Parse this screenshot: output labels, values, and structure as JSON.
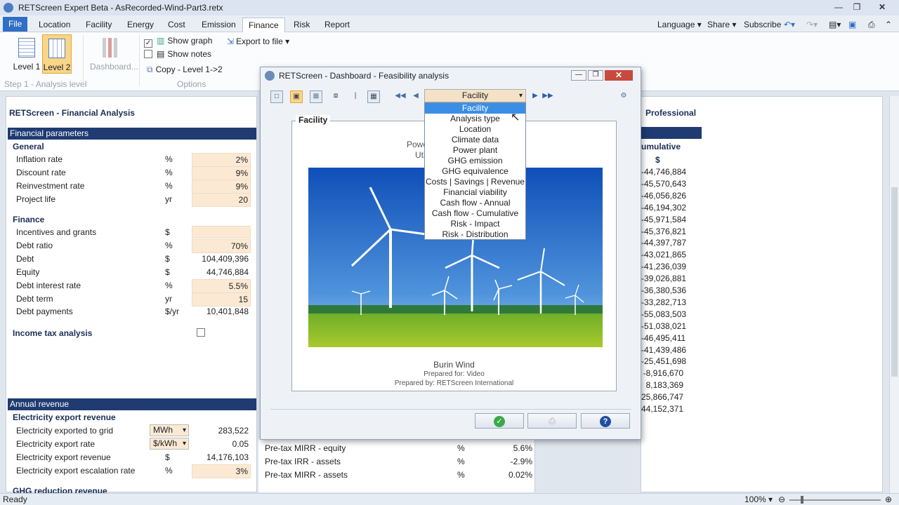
{
  "window": {
    "title": "RETScreen Expert Beta - AsRecorded-Wind-Part3.retx"
  },
  "menu": {
    "items": [
      "File",
      "Location",
      "Facility",
      "Energy",
      "Cost",
      "Emission",
      "Finance",
      "Risk",
      "Report"
    ],
    "right": [
      "Language",
      "Share",
      "Subscribe"
    ]
  },
  "ribbon": {
    "level1": "Level 1",
    "level2": "Level 2",
    "dashboard": "Dashboard...",
    "show_graph": "Show graph",
    "show_notes": "Show notes",
    "copy": "Copy - Level 1->2",
    "export": "Export to file",
    "group1": "Step 1 - Analysis level",
    "group2": "Options"
  },
  "left": {
    "title": "RETScreen - Financial Analysis",
    "section1": "Financial parameters",
    "general": "General",
    "general_rows": [
      {
        "label": "Inflation rate",
        "unit": "%",
        "value": "2%"
      },
      {
        "label": "Discount rate",
        "unit": "%",
        "value": "9%"
      },
      {
        "label": "Reinvestment rate",
        "unit": "%",
        "value": "9%"
      },
      {
        "label": "Project life",
        "unit": "yr",
        "value": "20"
      }
    ],
    "finance": "Finance",
    "finance_rows": [
      {
        "label": "Incentives and grants",
        "unit": "$",
        "value": ""
      },
      {
        "label": "Debt ratio",
        "unit": "%",
        "value": "70%"
      },
      {
        "label": "Debt",
        "unit": "$",
        "value": "104,409,396"
      },
      {
        "label": "Equity",
        "unit": "$",
        "value": "44,746,884"
      },
      {
        "label": "Debt interest rate",
        "unit": "%",
        "value": "5.5%"
      },
      {
        "label": "Debt term",
        "unit": "yr",
        "value": "15"
      },
      {
        "label": "Debt payments",
        "unit": "$/yr",
        "value": "10,401,848"
      }
    ],
    "income_tax": "Income tax analysis",
    "section2": "Annual revenue",
    "export_rev": "Electricity export revenue",
    "export_rows": [
      {
        "label": "Electricity exported to grid",
        "unit": "MWh",
        "value": "283,522"
      },
      {
        "label": "Electricity export rate",
        "unit": "$/kWh",
        "value": "0.05"
      },
      {
        "label": "Electricity export revenue",
        "unit": "$",
        "value": "14,176,103"
      },
      {
        "label": "Electricity export escalation rate",
        "unit": "%",
        "value": "3%"
      }
    ],
    "ghg": "GHG reduction revenue"
  },
  "middle_rows": [
    {
      "label": "Pre-tax MIRR - equity",
      "unit": "%",
      "value": "5.6%"
    },
    {
      "label": "Pre-tax IRR - assets",
      "unit": "%",
      "value": "-2.9%"
    },
    {
      "label": "Pre-tax MIRR - assets",
      "unit": "%",
      "value": "0.02%"
    }
  ],
  "right": {
    "title": "Professional",
    "col_header": "umulative",
    "col_unit": "$",
    "values": [
      "-44,746,884",
      "-45,570,643",
      "-46,056,826",
      "-46,194,302",
      "-45,971,584",
      "-45,376,821",
      "-44,397,787",
      "-43,021,865",
      "-41,236,039",
      "-39,026,881",
      "-36,380,536",
      "-33,282,713",
      "-55,083,503",
      "-51,038,021",
      "-46,495,411",
      "-41,439,486",
      "-25,451,698",
      "-8,916,670",
      "8,183,369",
      "25,866,747",
      "44,152,371"
    ]
  },
  "dialog": {
    "title": "RETScreen - Dashboard - Feasibility analysis",
    "selected": "Facility",
    "options": [
      "Facility",
      "Analysis type",
      "Location",
      "Climate data",
      "Power plant",
      "GHG emission",
      "GHG equivalence",
      "Costs | Savings | Revenue",
      "Financial viability",
      "Cash flow - Annual",
      "Cash flow - Cumulative",
      "Risk - Impact",
      "Risk - Distribution"
    ],
    "legend": "Facility",
    "hidden1": "Powe",
    "hidden2": "Uti",
    "project": "Burin Wind",
    "prepared_for": "Prepared for:  Video",
    "prepared_by": "Prepared by:  RETScreen International"
  },
  "status": {
    "text": "Ready",
    "zoom": "100%"
  }
}
